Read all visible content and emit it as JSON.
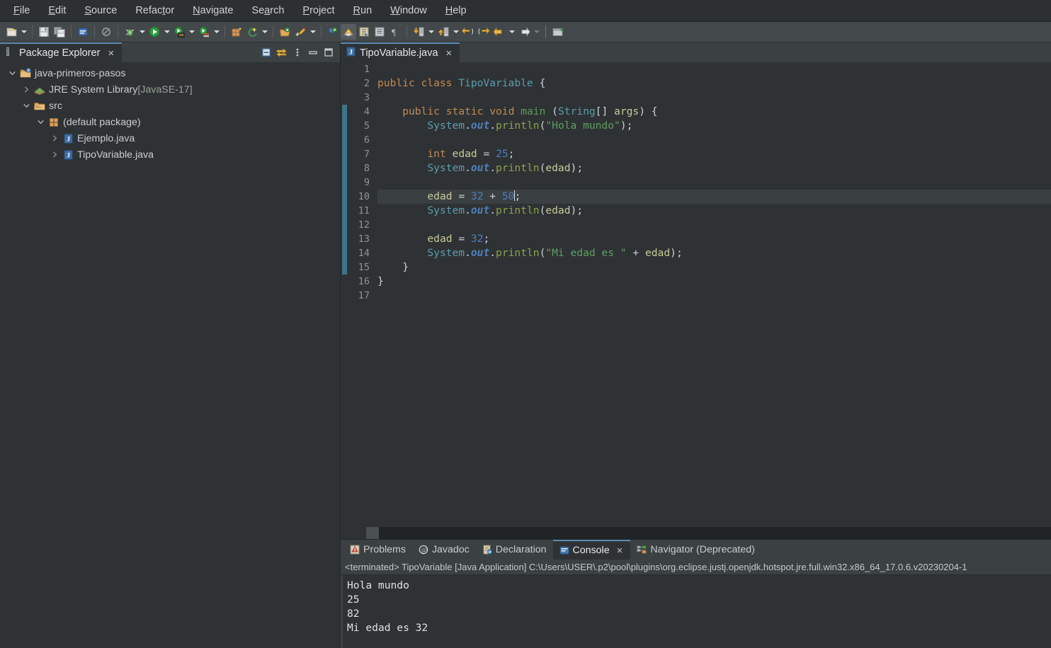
{
  "menubar": {
    "items": [
      {
        "label": "File",
        "mnemonic": "F"
      },
      {
        "label": "Edit",
        "mnemonic": "E"
      },
      {
        "label": "Source",
        "mnemonic": "S"
      },
      {
        "label": "Refactor",
        "mnemonic": "t"
      },
      {
        "label": "Navigate",
        "mnemonic": "N"
      },
      {
        "label": "Search",
        "mnemonic": "a"
      },
      {
        "label": "Project",
        "mnemonic": "P"
      },
      {
        "label": "Run",
        "mnemonic": "R"
      },
      {
        "label": "Window",
        "mnemonic": "W"
      },
      {
        "label": "Help",
        "mnemonic": "H"
      }
    ]
  },
  "toolbar": {
    "icons": [
      "new-wizard-icon",
      "save-icon",
      "save-all-icon",
      "new-java-class-icon",
      "toggle-breakpoint-icon",
      "debug-icon",
      "run-icon",
      "run-external-tools-icon",
      "coverage-icon",
      "new-java-project-icon",
      "new-annotation-icon",
      "open-type-icon",
      "open-task-icon",
      "skip-all-breakpoints-icon",
      "toggle-mark-occurrences-icon",
      "next-annotation-icon",
      "previous-annotation-icon",
      "show-whitespace-icon",
      "last-edit-location-icon",
      "back-icon",
      "forward-icon",
      "pin-editor-icon"
    ]
  },
  "package_explorer": {
    "title": "Package Explorer",
    "close_label": "×",
    "tools": [
      "collapse-all-icon",
      "link-with-editor-icon",
      "view-menu-icon",
      "minimize-icon",
      "maximize-icon"
    ],
    "tree": [
      {
        "label": "java-primeros-pasos",
        "suffix": "",
        "indent": 0,
        "expanded": true,
        "icon": "java-project-icon"
      },
      {
        "label": "JRE System Library",
        "suffix": " [JavaSE-17]",
        "indent": 1,
        "expanded": false,
        "icon": "jre-library-icon"
      },
      {
        "label": "src",
        "suffix": "",
        "indent": 1,
        "expanded": true,
        "icon": "source-folder-icon"
      },
      {
        "label": "(default package)",
        "suffix": "",
        "indent": 2,
        "expanded": true,
        "icon": "package-icon"
      },
      {
        "label": "Ejemplo.java",
        "suffix": "",
        "indent": 3,
        "expanded": false,
        "icon": "java-file-icon"
      },
      {
        "label": "TipoVariable.java",
        "suffix": "",
        "indent": 3,
        "expanded": false,
        "icon": "java-file-icon"
      }
    ]
  },
  "editor": {
    "tab_label": "TipoVariable.java",
    "tab_icon": "java-file-icon",
    "close_label": "×",
    "highlighted_line": 10,
    "cursor_line": 10,
    "method_bar_from_line": 4,
    "method_bar_to_line": 15,
    "fold_marker_line": 4,
    "line_numbers": [
      1,
      2,
      3,
      4,
      5,
      6,
      7,
      8,
      9,
      10,
      11,
      12,
      13,
      14,
      15,
      16,
      17
    ],
    "code_lines": [
      "",
      "public class TipoVariable {",
      "",
      "    public static void main (String[] args) {",
      "        System.out.println(\"Hola mundo\");",
      "",
      "        int edad = 25;",
      "        System.out.println(edad);",
      "",
      "        edad = 32 + 50;",
      "        System.out.println(edad);",
      "",
      "        edad = 32;",
      "        System.out.println(\"Mi edad es \" + edad);",
      "    }",
      "}",
      ""
    ],
    "scrollbar_left_arrow": "‹"
  },
  "bottom_panel": {
    "tabs": [
      {
        "label": "Problems",
        "icon": "problems-icon",
        "active": false,
        "closable": false
      },
      {
        "label": "Javadoc",
        "icon": "javadoc-icon",
        "active": false,
        "closable": false
      },
      {
        "label": "Declaration",
        "icon": "declaration-icon",
        "active": false,
        "closable": false
      },
      {
        "label": "Console",
        "icon": "console-icon",
        "active": true,
        "closable": true
      },
      {
        "label": "Navigator (Deprecated)",
        "icon": "navigator-icon",
        "active": false,
        "closable": false
      }
    ],
    "close_label": "×",
    "console_header": "<terminated> TipoVariable [Java Application] C:\\Users\\USER\\.p2\\pool\\plugins\\org.eclipse.justj.openjdk.hotspot.jre.full.win32.x86_64_17.0.6.v20230204-1",
    "console_output": [
      "Hola mundo",
      "25",
      "82",
      "Mi edad es 32"
    ]
  },
  "colors": {
    "window_bg": "#2f3234",
    "menubar_bg": "#2d3032",
    "toolbar_bg": "#43484b",
    "tabbar_bg": "#3b4043",
    "active_tab_accent": "#5c8db5",
    "keyword": "#c08a54",
    "type": "#5b9cb0",
    "string": "#5f9e63",
    "number": "#4a7fbf",
    "variable": "#c7c99a",
    "method": "#8aa34b",
    "static_field": "#4f7fbd",
    "method_bar": "#3f7b91",
    "line_highlight": "#3a3f42",
    "text": "#cfd2d4"
  }
}
